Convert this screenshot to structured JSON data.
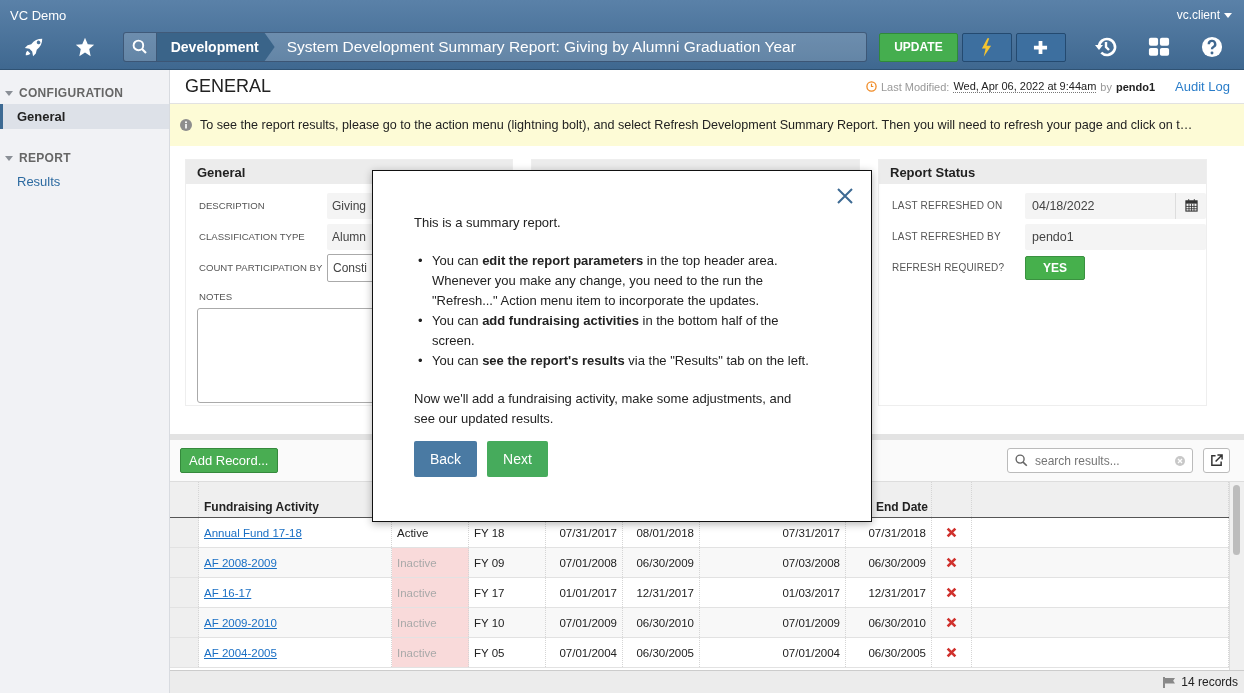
{
  "app": {
    "title": "VC Demo",
    "user": "vc.client"
  },
  "breadcrumb": {
    "module": "Development",
    "title": "System Development Summary Report: Giving by Alumni Graduation Year"
  },
  "toolbar": {
    "update_label": "UPDATE"
  },
  "sidebar": {
    "sections": [
      {
        "label": "CONFIGURATION",
        "expanded": true,
        "items": [
          {
            "label": "General",
            "selected": true
          }
        ]
      },
      {
        "label": "REPORT",
        "expanded": true,
        "items": [
          {
            "label": "Results",
            "selected": false
          }
        ]
      }
    ]
  },
  "page": {
    "title": "GENERAL",
    "modified_label": "Last Modified:",
    "modified_value": "Wed, Apr 06, 2022 at 9:44am",
    "by_label": "by",
    "by_value": "pendo1",
    "audit_link": "Audit Log"
  },
  "notice": "To see the report results, please go to the action menu (lightning bolt), and select Refresh Development Summary Report. Then you will need to refresh your page and click on t…",
  "general_panel": {
    "title": "General",
    "fields": [
      {
        "label": "DESCRIPTION",
        "value": "Giving",
        "kind": "text"
      },
      {
        "label": "CLASSIFICATION TYPE",
        "value": "Alumn",
        "kind": "text"
      },
      {
        "label": "COUNT PARTICIPATION BY",
        "value": "Consti",
        "kind": "select"
      }
    ],
    "notes_label": "NOTES"
  },
  "status_panel": {
    "title": "Report Status",
    "fields": [
      {
        "label": "LAST REFRESHED ON",
        "value": "04/18/2022",
        "kind": "date"
      },
      {
        "label": "LAST REFRESHED BY",
        "value": "pendo1",
        "kind": "text"
      },
      {
        "label": "REFRESH REQUIRED?",
        "value": "YES",
        "kind": "badge"
      }
    ]
  },
  "modal": {
    "intro": "This is a summary report.",
    "bullets": [
      {
        "marker": "•",
        "text": "You can **edit the report parameters** in the top header area. Whenever you make any change, you need to the run the \"Refresh...\" Action menu item to incorporate the updates."
      },
      {
        "marker": "•",
        "text": "You can **add fundraising activities** in the bottom half of the screen."
      },
      {
        "marker": "•",
        "text": "You can **see the report's results** via the \"Results\" tab on the left."
      }
    ],
    "outro": "Now we'll add a fundraising activity, make some adjustments, and see our updated results.",
    "buttons": [
      {
        "label": "Back",
        "kind": "secondary"
      },
      {
        "label": "Next",
        "kind": "primary"
      }
    ]
  },
  "table": {
    "add_button": "Add Record...",
    "search": {
      "placeholder": "search results..."
    },
    "header": {
      "activity": "Fundraising Activity",
      "end_date": "End Date"
    },
    "rows": [
      {
        "name": "Annual Fund 17-18",
        "status": "Active",
        "active": true,
        "cells": [
          "FY 18",
          "07/31/2017",
          "08/01/2018",
          "07/31/2017",
          "07/31/2018"
        ]
      },
      {
        "name": "AF 2008-2009",
        "status": "Inactive",
        "active": false,
        "cells": [
          "FY 09",
          "07/01/2008",
          "06/30/2009",
          "07/03/2008",
          "06/30/2009"
        ]
      },
      {
        "name": "AF 16-17",
        "status": "Inactive",
        "active": false,
        "cells": [
          "FY 17",
          "01/01/2017",
          "12/31/2017",
          "01/03/2017",
          "12/31/2017"
        ]
      },
      {
        "name": "AF 2009-2010",
        "status": "Inactive",
        "active": false,
        "cells": [
          "FY 10",
          "07/01/2009",
          "06/30/2010",
          "07/01/2009",
          "06/30/2010"
        ]
      },
      {
        "name": "AF 2004-2005",
        "status": "Inactive",
        "active": false,
        "cells": [
          "FY 05",
          "07/01/2004",
          "06/30/2005",
          "07/01/2004",
          "06/30/2005"
        ]
      }
    ],
    "records": "14 records"
  }
}
